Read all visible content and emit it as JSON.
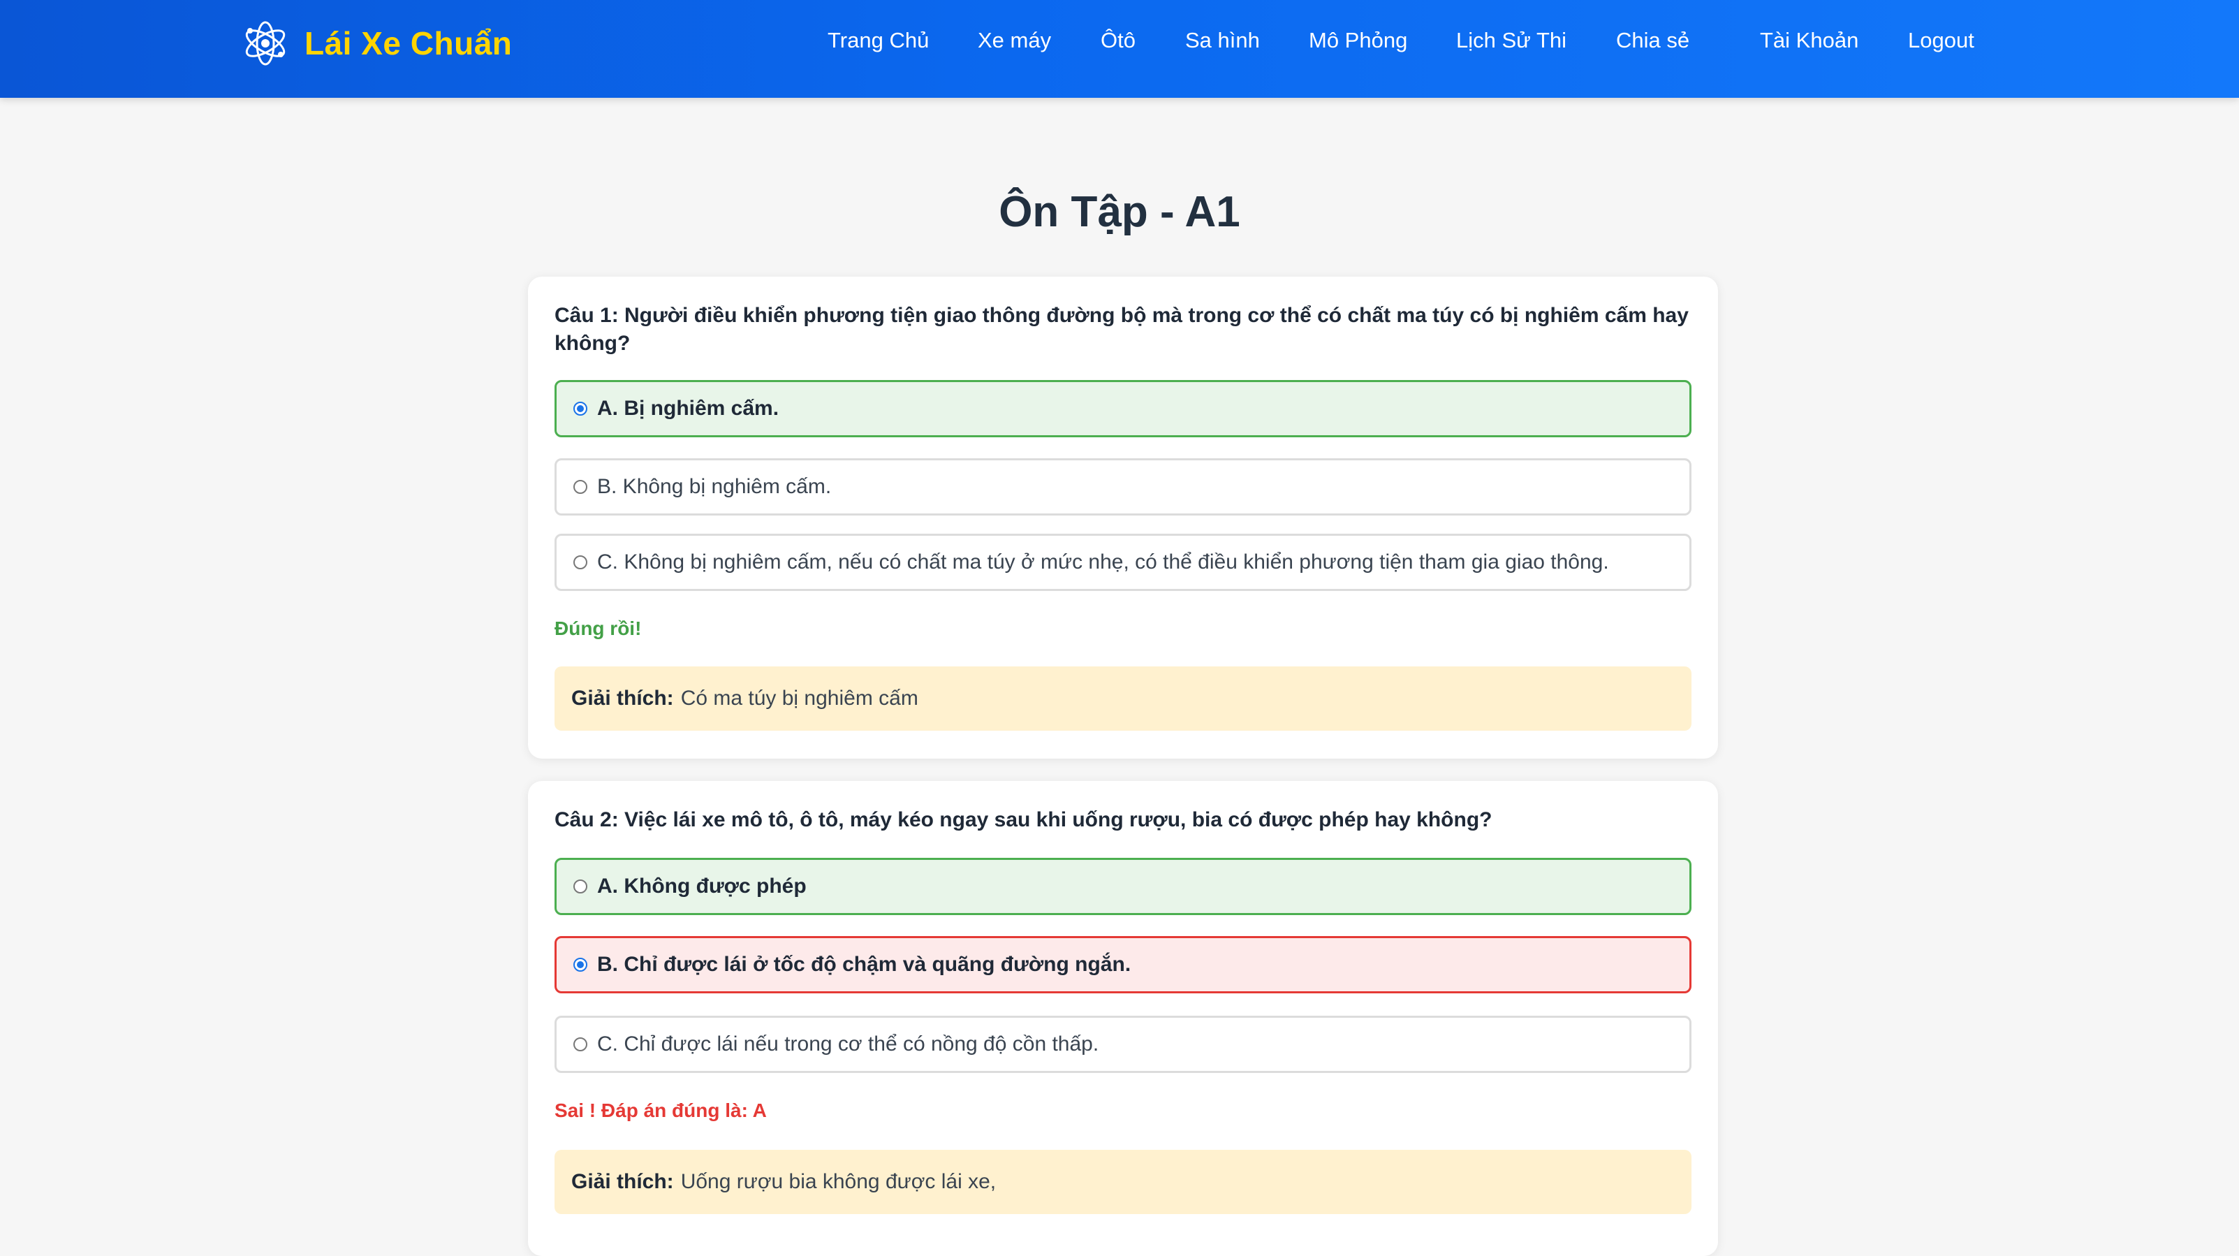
{
  "brand": {
    "name": "Lái Xe Chuẩn",
    "logo_icon": "atom-logo-icon"
  },
  "nav": {
    "items": [
      {
        "label": "Trang Chủ"
      },
      {
        "label": "Xe máy"
      },
      {
        "label": "Ôtô"
      },
      {
        "label": "Sa hình"
      },
      {
        "label": "Mô Phỏng"
      },
      {
        "label": "Lịch Sử Thi"
      },
      {
        "label": "Chia sẻ"
      },
      {
        "label": "Tài Khoản"
      },
      {
        "label": "Logout"
      }
    ]
  },
  "page": {
    "title": "Ôn Tập - A1"
  },
  "questions": [
    {
      "text": "Câu 1: Người điều khiển phương tiện giao thông đường bộ mà trong cơ thể có chất ma túy có bị nghiêm cấm hay không?",
      "options": [
        {
          "label": "A. Bị nghiêm cấm.",
          "state": "correct",
          "selected": true
        },
        {
          "label": "B. Không bị nghiêm cấm.",
          "state": "normal",
          "selected": false
        },
        {
          "label": "C. Không bị nghiêm cấm, nếu có chất ma túy ở mức nhẹ, có thể điều khiển phương tiện tham gia giao thông.",
          "state": "normal",
          "selected": false
        }
      ],
      "feedback": "Đúng rồi!",
      "explain_label": "Giải thích:",
      "explain_text": "Có ma túy bị nghiêm cấm"
    },
    {
      "text": "Câu 2: Việc lái xe mô tô, ô tô, máy kéo ngay sau khi uống rượu, bia có được phép hay không?",
      "options": [
        {
          "label": "A. Không được phép",
          "state": "correct",
          "selected": false
        },
        {
          "label": "B. Chỉ được lái ở tốc độ chậm và quãng đường ngắn.",
          "state": "wrong",
          "selected": true
        },
        {
          "label": "C. Chỉ được lái nếu trong cơ thể có nồng độ cồn thấp.",
          "state": "normal",
          "selected": false
        }
      ],
      "feedback": "Sai ! Đáp án đúng là: A",
      "explain_label": "Giải thích:",
      "explain_text": "Uống rượu bia không được lái xe,"
    }
  ],
  "colors": {
    "navbar": "#0b68ef",
    "brand": "#ffd400",
    "correct_border": "#4caf50",
    "correct_bg": "#e8f5e9",
    "wrong_border": "#e53935",
    "wrong_bg": "#fdeaea",
    "feedback_correct": "#43a047",
    "feedback_wrong": "#e53935",
    "explain_bg": "#fff1cf"
  }
}
